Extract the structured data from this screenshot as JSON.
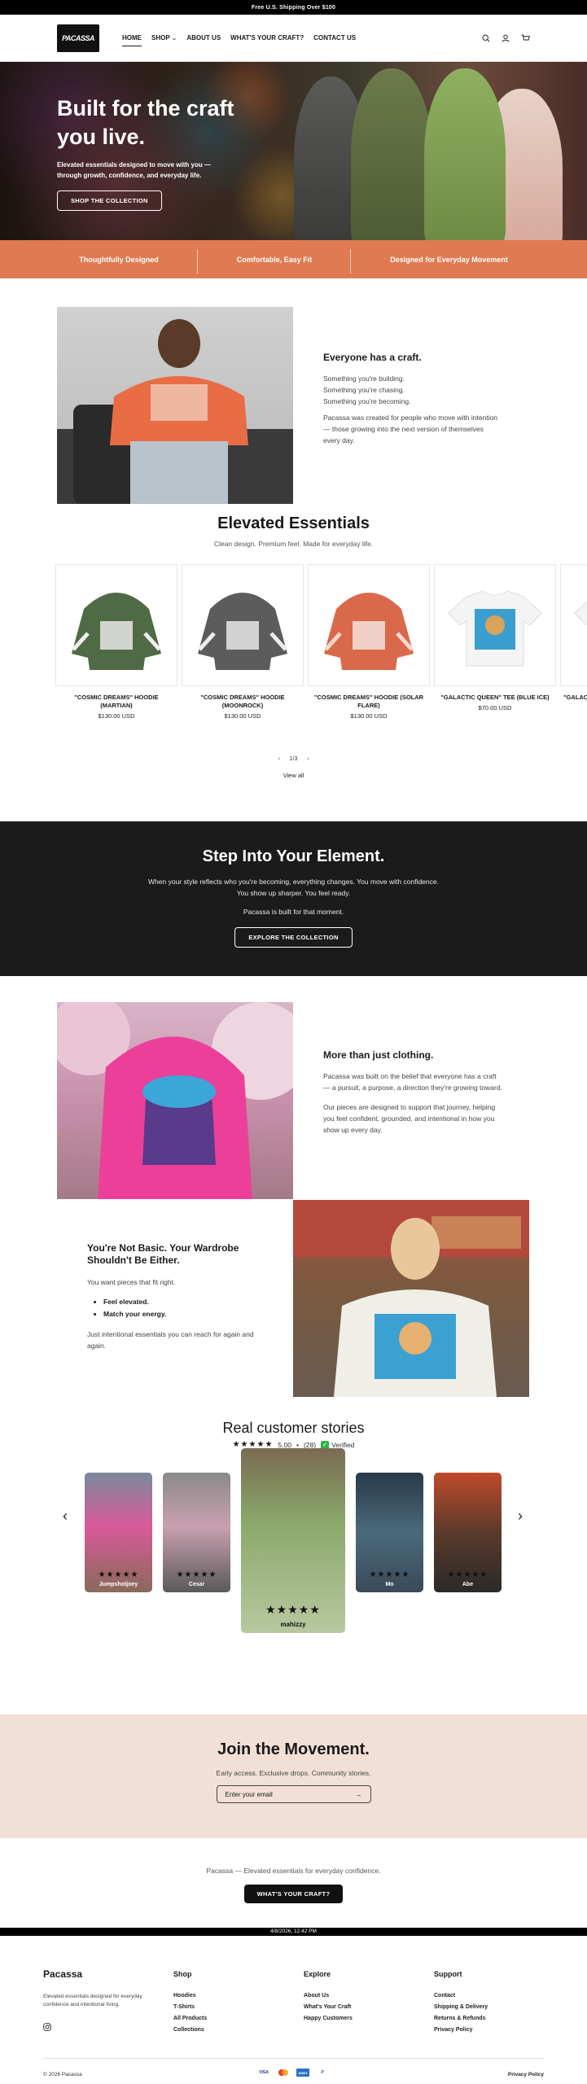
{
  "announcement": "Free U.S. Shipping Over $100",
  "header": {
    "logo_text": "PACASSA",
    "nav": [
      "HOME",
      "SHOP",
      "ABOUT US",
      "WHAT'S YOUR CRAFT?",
      "CONTACT US"
    ],
    "shop_chevron": "⌄",
    "icons": [
      "search-icon",
      "account-icon",
      "cart-icon"
    ]
  },
  "hero": {
    "title": "Built for the craft you live.",
    "subtitle": "Elevated essentials designed to move with you — through growth, confidence, and everyday life.",
    "cta": "SHOP THE COLLECTION"
  },
  "features": [
    "Thoughtfully Designed",
    "Comfortable, Easy Fit",
    "Designed for Everyday Movement"
  ],
  "craft": {
    "title": "Everyone has a craft.",
    "lines": [
      "Something you're building.",
      "Something you're chasing.",
      "Something you're becoming."
    ],
    "body": "Pacassa was created for people who move with intention — those growing into the next version of themselves every day."
  },
  "essentials": {
    "title": "Elevated Essentials",
    "subtitle": "Clean design. Premium feel. Made for everyday life.",
    "products": [
      {
        "name": "\"COSMIC DREAMS\" HOODIE (MARTIAN)",
        "price": "$130.00 USD",
        "color": "#4f6b45"
      },
      {
        "name": "\"COSMIC DREAMS\" HOODIE (MOONROCK)",
        "price": "$130.00 USD",
        "color": "#5c5c5c"
      },
      {
        "name": "\"COSMIC DREAMS\" HOODIE (SOLAR FLARE)",
        "price": "$130.00 USD",
        "color": "#d9694a"
      },
      {
        "name": "\"GALACTIC QUEEN\" TEE (BLUE ICE)",
        "price": "$70.00 USD",
        "color": "#f2f2f2"
      },
      {
        "name": "\"GALAC",
        "price": "",
        "color": "#f2f2f2"
      }
    ],
    "pager_prev": "‹",
    "pager": "1/3",
    "pager_next": "›",
    "view_all": "View all"
  },
  "element": {
    "title": "Step Into Your Element.",
    "line1": "When your style reflects who you're becoming, everything changes. You move with confidence.",
    "line2": "You show up sharper. You feel ready.",
    "line3": "Pacassa is built for that moment.",
    "cta": "EXPLORE THE COLLECTION"
  },
  "more": {
    "title": "More than just clothing.",
    "p1": "Pacassa was built on the belief that everyone has a craft — a pursuit, a purpose, a direction they're growing toward.",
    "p2": "Our pieces are designed to support that journey, helping you feel confident, grounded, and intentional in how you show up every day."
  },
  "basic": {
    "title": "You're Not Basic. Your Wardrobe Shouldn't Be Either.",
    "intro": "You want pieces that fit right.",
    "bullets": [
      "Feel elevated.",
      "Match your energy."
    ],
    "outro": "Just intentional essentials you can reach for again and again."
  },
  "reviews": {
    "title": "Real customer stories",
    "stars": "★★★★★",
    "score": "5.00",
    "count": "(28)",
    "verified": "Verified",
    "prev": "‹",
    "next": "›",
    "items": [
      {
        "name": "Jumpshotjoey",
        "stars": "★★★★★"
      },
      {
        "name": "Cesar",
        "stars": "★★★★★"
      },
      {
        "name": "mahizzy",
        "stars": "★★★★★"
      },
      {
        "name": "Mo",
        "stars": "★★★★★"
      },
      {
        "name": "Abe",
        "stars": "★★★★★"
      }
    ]
  },
  "join": {
    "title": "Join the Movement.",
    "subtitle": "Early access. Exclusive drops. Community stories.",
    "email_placeholder": "Enter your email",
    "submit_arrow": "→"
  },
  "closing": {
    "text": "Pacassa — Elevated essentials for everyday confidence.",
    "cta": "WHAT'S YOUR CRAFT?"
  },
  "timestamp": "4/8/2026, 12:42 PM",
  "footer": {
    "brand": "Pacassa",
    "brand_desc": "Elevated essentials designed for everyday confidence and intentional living.",
    "columns": [
      {
        "title": "Shop",
        "links": [
          "Hoodies",
          "T-Shirts",
          "All Products",
          "Collections"
        ]
      },
      {
        "title": "Explore",
        "links": [
          "About Us",
          "What's Your Craft",
          "Happy Customers"
        ]
      },
      {
        "title": "Support",
        "links": [
          "Contact",
          "Shipping & Delivery",
          "Returns & Refunds",
          "Privacy Policy"
        ]
      }
    ],
    "copyright": "© 2026 Pacassa",
    "payments": [
      "VISA",
      "MC",
      "AMEX",
      "P"
    ],
    "privacy": "Privacy Policy"
  }
}
